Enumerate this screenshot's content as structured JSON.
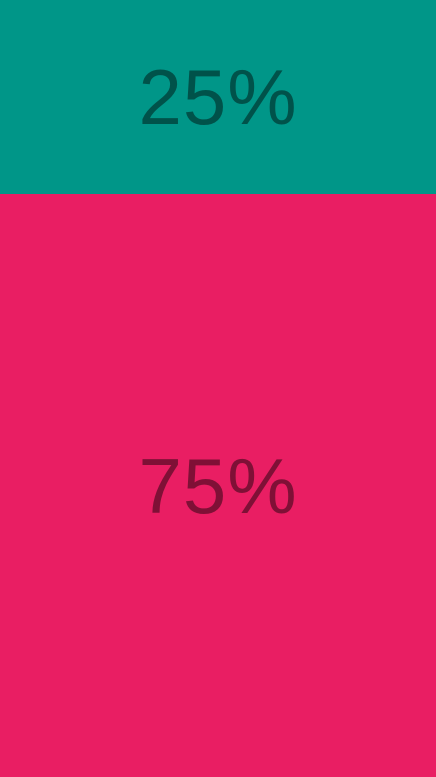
{
  "panels": [
    {
      "name": "top",
      "label": "25%",
      "value_percent": 25,
      "color": "#009688"
    },
    {
      "name": "bottom",
      "label": "75%",
      "value_percent": 75,
      "color": "#E91E63"
    }
  ]
}
